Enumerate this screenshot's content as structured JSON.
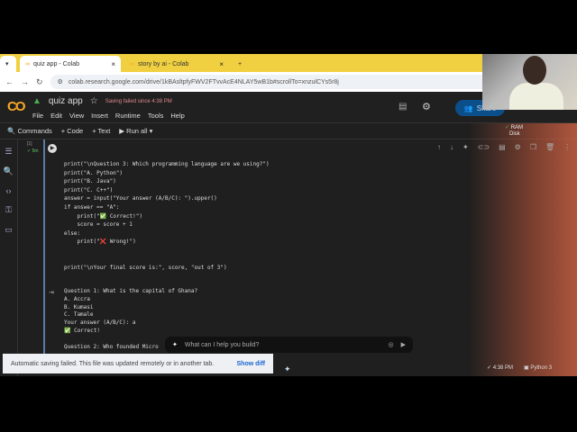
{
  "browser": {
    "tabs": [
      {
        "label": "quiz app - Colab",
        "active": true
      },
      {
        "label": "story by ai - Colab",
        "active": false
      }
    ],
    "url": "colab.research.google.com/drive/1kBAsltpfyFWV2FTvvAcE4NLAY5wB1b#scrollTo=xnzulCYs5r8j"
  },
  "colab": {
    "logo": "CO",
    "title": "quiz app",
    "save_status": "Saving failed since 4:38 PM",
    "menu": [
      "File",
      "Edit",
      "View",
      "Insert",
      "Runtime",
      "Tools",
      "Help"
    ],
    "toolbar": {
      "commands": "Commands",
      "code": "+ Code",
      "text": "+ Text",
      "run_all": "Run all"
    },
    "share": "Share",
    "ram": "RAM",
    "disk": "Disk",
    "cell_index": "[1]",
    "cell_time": "✓ 5m"
  },
  "code_lines": [
    "print(\"\\nQuestion 3: Which programming language are we using?\")",
    "print(\"A. Python\")",
    "print(\"B. Java\")",
    "print(\"C. C++\")",
    "answer = input(\"Your answer (A/B/C): \").upper()",
    "if answer == \"A\":",
    "    print(\"✅ Correct!\")",
    "    score = score + 1",
    "else:",
    "    print(\"❌ Wrong!\")",
    "",
    "",
    "print(\"\\nYour final score is:\", score, \"out of 3\")"
  ],
  "output_lines": [
    "Question 1: What is the capital of Ghana?",
    "A. Accra",
    "B. Kumasi",
    "C. Tamale",
    "Your answer (A/B/C): a",
    "✅ Correct!",
    "",
    "Question 2: Who founded Micro"
  ],
  "ai_prompt": {
    "placeholder": "What can I help you build?"
  },
  "toast": {
    "message": "Automatic saving failed. This file was updated remotely or in another tab.",
    "action": "Show diff"
  },
  "statusbar": {
    "time": "✓ 4:38 PM",
    "runtime": "Python 3"
  }
}
